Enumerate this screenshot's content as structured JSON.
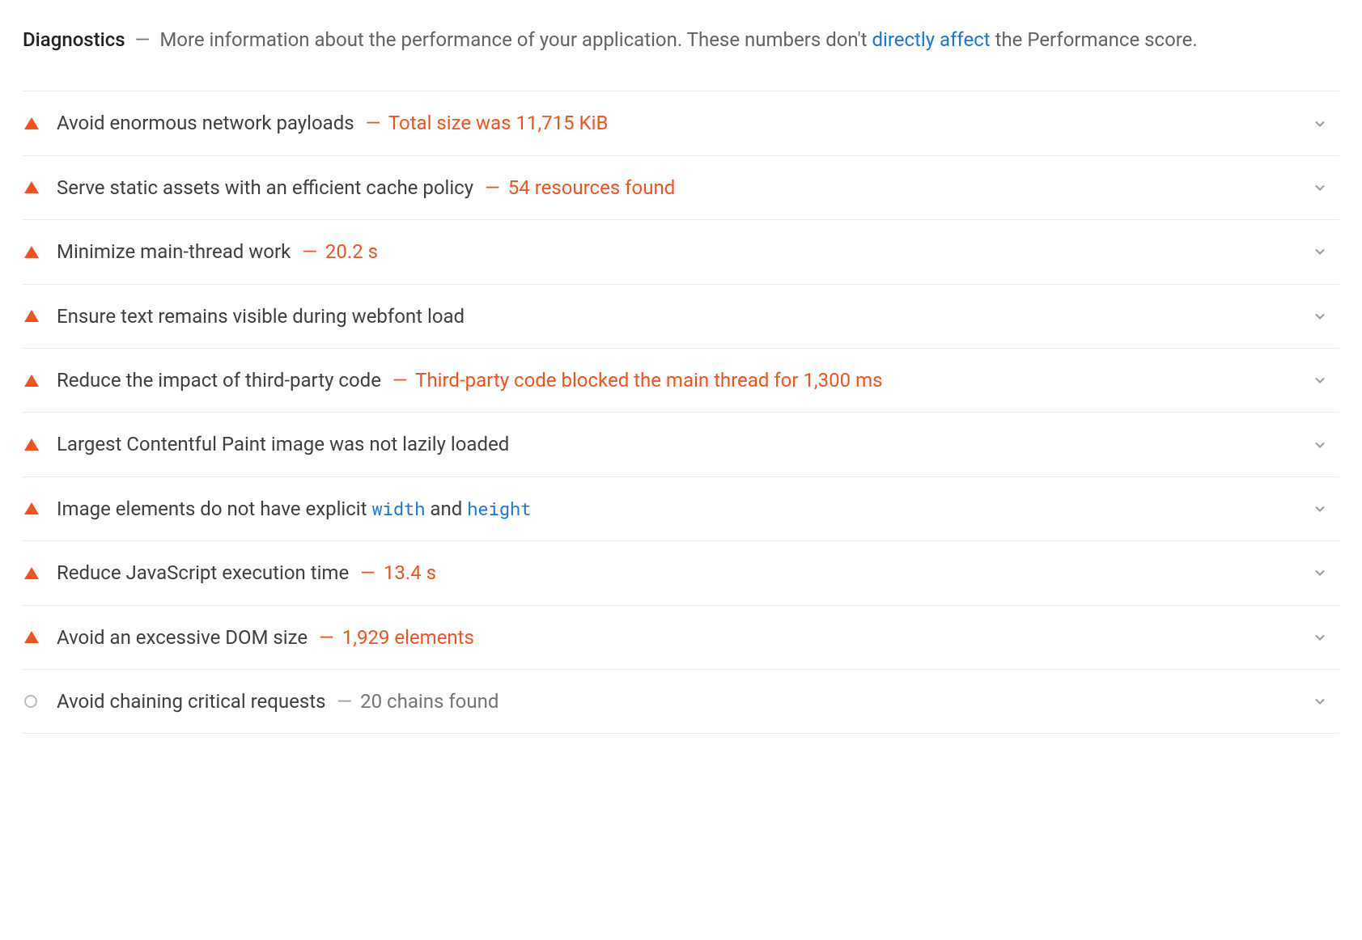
{
  "header": {
    "title": "Diagnostics",
    "dash": "—",
    "desc_pre": "More information about the performance of your application. These numbers don't ",
    "link": "directly affect",
    "desc_post": " the Performance score."
  },
  "sep_red": "—",
  "sep_gray": "—",
  "items": [
    {
      "severity": "warn",
      "label": "Avoid enormous network payloads",
      "detail": "Total size was 11,715 KiB"
    },
    {
      "severity": "warn",
      "label": "Serve static assets with an efficient cache policy",
      "detail": "54 resources found"
    },
    {
      "severity": "warn",
      "label": "Minimize main-thread work",
      "detail": "20.2 s"
    },
    {
      "severity": "warn",
      "label": "Ensure text remains visible during webfont load",
      "detail": ""
    },
    {
      "severity": "warn",
      "label": "Reduce the impact of third-party code",
      "detail": "Third-party code blocked the main thread for 1,300 ms"
    },
    {
      "severity": "warn",
      "label": "Largest Contentful Paint image was not lazily loaded",
      "detail": ""
    },
    {
      "severity": "warn",
      "label_pre": "Image elements do not have explicit ",
      "code1": "width",
      "between": " and ",
      "code2": "height",
      "detail": ""
    },
    {
      "severity": "warn",
      "label": "Reduce JavaScript execution time",
      "detail": "13.4 s"
    },
    {
      "severity": "warn",
      "label": "Avoid an excessive DOM size",
      "detail": "1,929 elements"
    },
    {
      "severity": "info",
      "label": "Avoid chaining critical requests",
      "detail": "20 chains found"
    }
  ]
}
